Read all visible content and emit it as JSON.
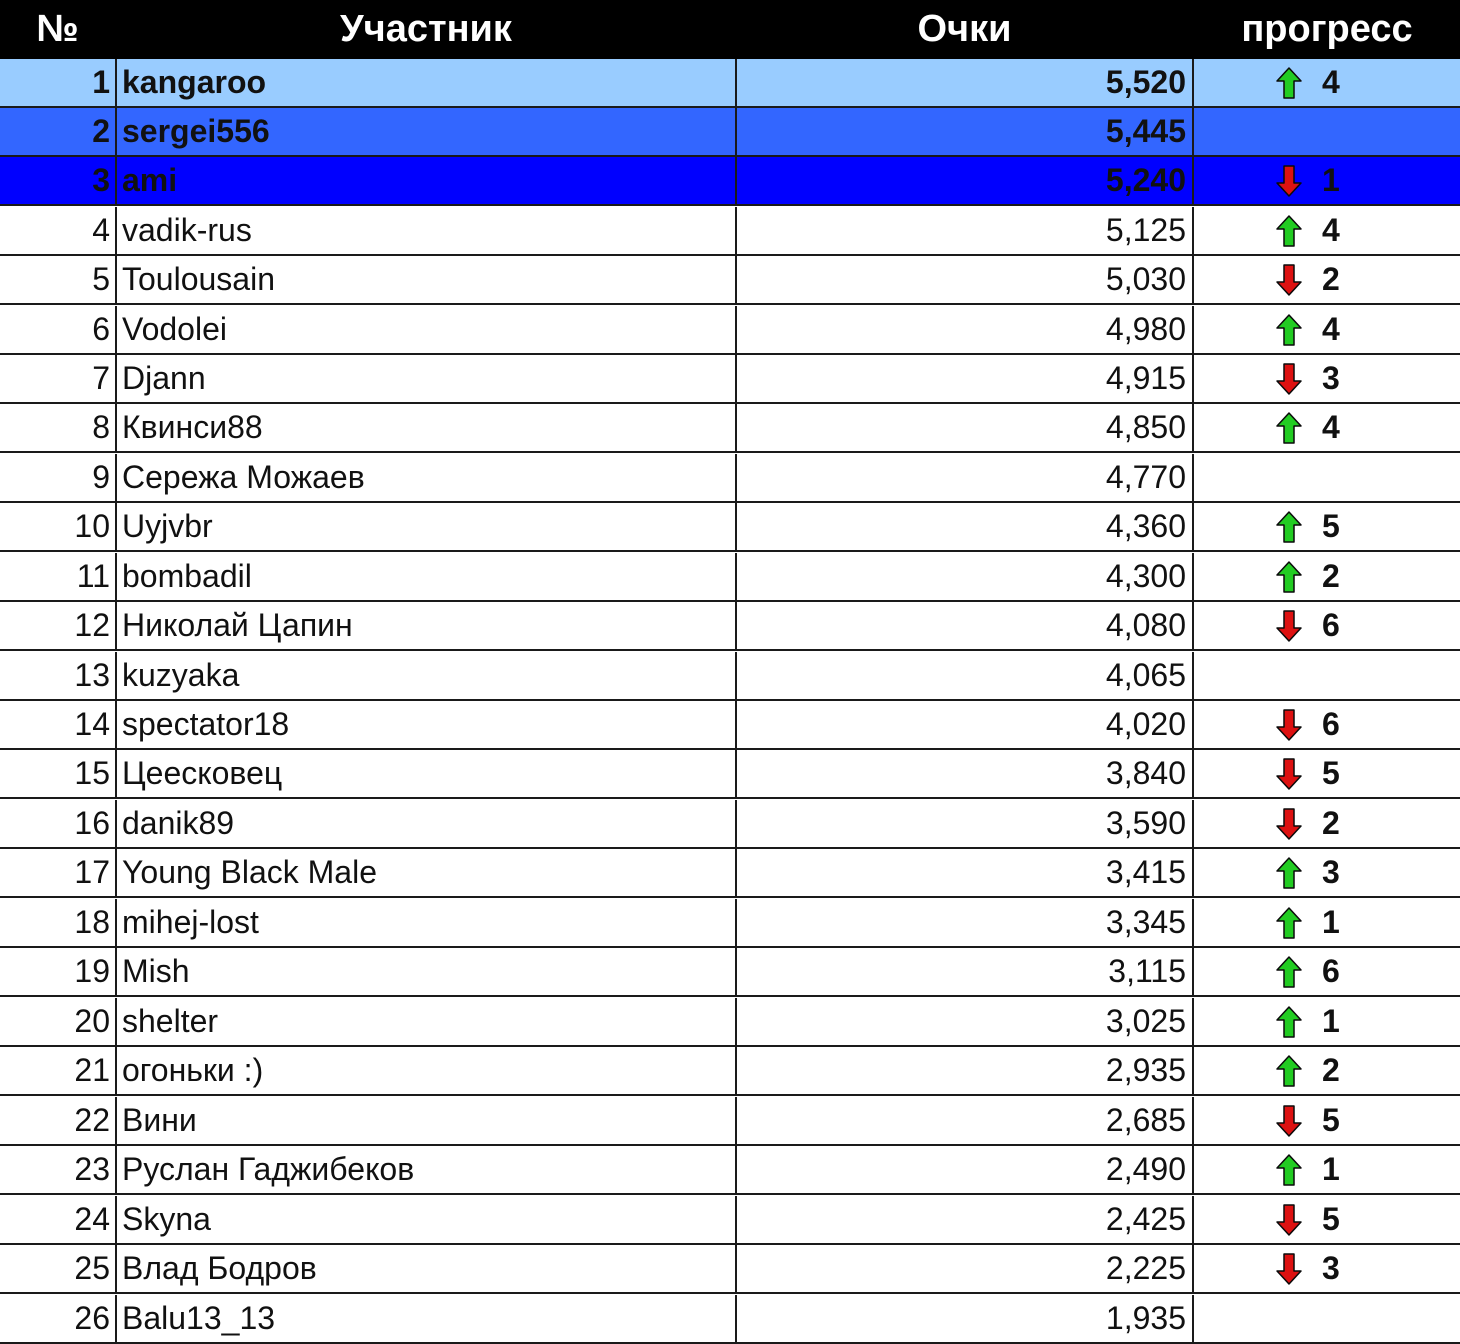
{
  "header": {
    "num": "№",
    "participant": "Участник",
    "points": "Очки",
    "progress": "прогресс"
  },
  "colors": {
    "header_bg": "#000000",
    "header_text": "#ffffff",
    "row1_bg": "#99ccff",
    "row2_bg": "#3366ff",
    "row3_bg": "#0000ff",
    "up_arrow": "#22cc22",
    "down_arrow": "#dd1111"
  },
  "rows": [
    {
      "rank": "1",
      "name": "kangaroo",
      "score": "5,520",
      "dir": "up",
      "change": "4"
    },
    {
      "rank": "2",
      "name": "sergei556",
      "score": "5,445",
      "dir": "",
      "change": ""
    },
    {
      "rank": "3",
      "name": "ami",
      "score": "5,240",
      "dir": "down",
      "change": "1"
    },
    {
      "rank": "4",
      "name": "vadik-rus",
      "score": "5,125",
      "dir": "up",
      "change": "4"
    },
    {
      "rank": "5",
      "name": "Toulousain",
      "score": "5,030",
      "dir": "down",
      "change": "2"
    },
    {
      "rank": "6",
      "name": "Vodolei",
      "score": "4,980",
      "dir": "up",
      "change": "4"
    },
    {
      "rank": "7",
      "name": "Djann",
      "score": "4,915",
      "dir": "down",
      "change": "3"
    },
    {
      "rank": "8",
      "name": "Квинси88",
      "score": "4,850",
      "dir": "up",
      "change": "4"
    },
    {
      "rank": "9",
      "name": "Сережа Можаев",
      "score": "4,770",
      "dir": "",
      "change": ""
    },
    {
      "rank": "10",
      "name": "Uyjvbr",
      "score": "4,360",
      "dir": "up",
      "change": "5"
    },
    {
      "rank": "11",
      "name": "bombadil",
      "score": "4,300",
      "dir": "up",
      "change": "2"
    },
    {
      "rank": "12",
      "name": "Николай Цапин",
      "score": "4,080",
      "dir": "down",
      "change": "6"
    },
    {
      "rank": "13",
      "name": "kuzyaka",
      "score": "4,065",
      "dir": "",
      "change": ""
    },
    {
      "rank": "14",
      "name": "spectator18",
      "score": "4,020",
      "dir": "down",
      "change": "6"
    },
    {
      "rank": "15",
      "name": "Цеесковец",
      "score": "3,840",
      "dir": "down",
      "change": "5"
    },
    {
      "rank": "16",
      "name": "danik89",
      "score": "3,590",
      "dir": "down",
      "change": "2"
    },
    {
      "rank": "17",
      "name": "Young Black Male",
      "score": "3,415",
      "dir": "up",
      "change": "3"
    },
    {
      "rank": "18",
      "name": "mihej-lost",
      "score": "3,345",
      "dir": "up",
      "change": "1"
    },
    {
      "rank": "19",
      "name": "Mish",
      "score": "3,115",
      "dir": "up",
      "change": "6"
    },
    {
      "rank": "20",
      "name": "shelter",
      "score": "3,025",
      "dir": "up",
      "change": "1"
    },
    {
      "rank": "21",
      "name": "огоньки :)",
      "score": "2,935",
      "dir": "up",
      "change": "2"
    },
    {
      "rank": "22",
      "name": "Вини",
      "score": "2,685",
      "dir": "down",
      "change": "5"
    },
    {
      "rank": "23",
      "name": "Руслан Гаджибеков",
      "score": "2,490",
      "dir": "up",
      "change": "1"
    },
    {
      "rank": "24",
      "name": "Skyna",
      "score": "2,425",
      "dir": "down",
      "change": "5"
    },
    {
      "rank": "25",
      "name": "Влад Бодров",
      "score": "2,225",
      "dir": "down",
      "change": "3"
    },
    {
      "rank": "26",
      "name": "Balu13_13",
      "score": "1,935",
      "dir": "",
      "change": ""
    }
  ]
}
